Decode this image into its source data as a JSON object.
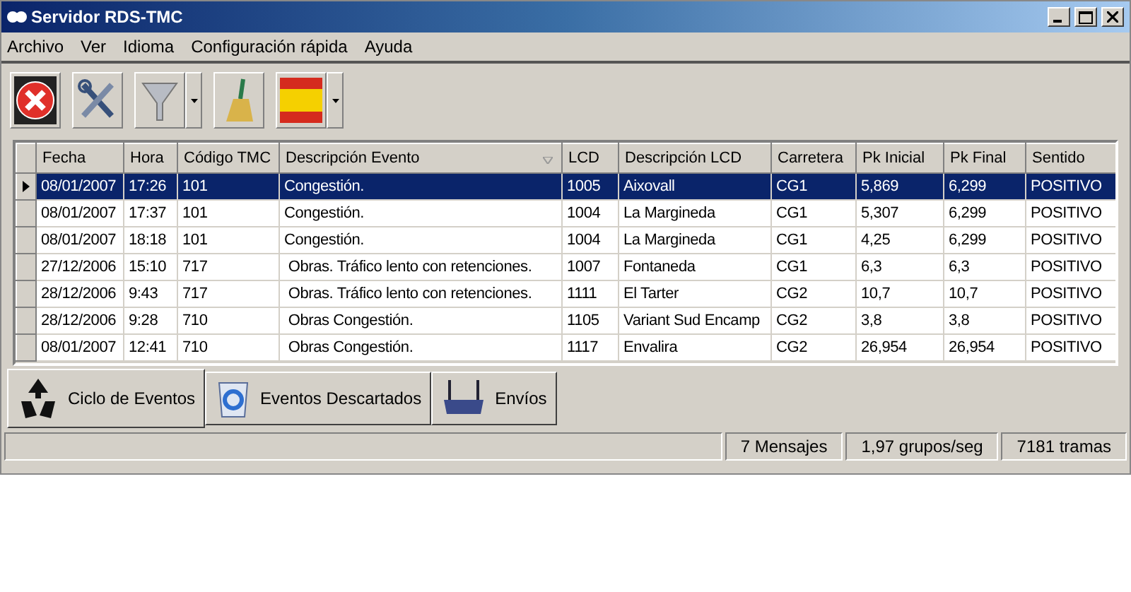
{
  "window": {
    "title": "Servidor RDS-TMC"
  },
  "menu": [
    "Archivo",
    "Ver",
    "Idioma",
    "Configuración rápida",
    "Ayuda"
  ],
  "toolbar": [
    {
      "kind": "exit",
      "dropdown": false
    },
    {
      "kind": "tools",
      "dropdown": false
    },
    {
      "kind": "filter",
      "dropdown": true
    },
    {
      "kind": "broom",
      "dropdown": false
    },
    {
      "kind": "flag",
      "dropdown": true
    }
  ],
  "table": {
    "columns": [
      {
        "label": "Fecha",
        "sorted": false
      },
      {
        "label": "Hora",
        "sorted": false
      },
      {
        "label": "Código TMC",
        "sorted": false
      },
      {
        "label": "Descripción Evento",
        "sorted": true
      },
      {
        "label": "LCD",
        "sorted": false
      },
      {
        "label": "Descripción LCD",
        "sorted": false
      },
      {
        "label": "Carretera",
        "sorted": false
      },
      {
        "label": "Pk Inicial",
        "sorted": false
      },
      {
        "label": "Pk Final",
        "sorted": false
      },
      {
        "label": "Sentido",
        "sorted": false
      }
    ],
    "rows": [
      {
        "selected": true,
        "cells": [
          "08/01/2007",
          "17:26",
          "101",
          "Congestión.",
          "1005",
          "Aixovall",
          "CG1",
          "5,869",
          "6,299",
          "POSITIVO"
        ]
      },
      {
        "selected": false,
        "cells": [
          "08/01/2007",
          "17:37",
          "101",
          "Congestión.",
          "1004",
          "La Margineda",
          "CG1",
          "5,307",
          "6,299",
          "POSITIVO"
        ]
      },
      {
        "selected": false,
        "cells": [
          "08/01/2007",
          "18:18",
          "101",
          "Congestión.",
          "1004",
          "La Margineda",
          "CG1",
          "4,25",
          "6,299",
          "POSITIVO"
        ]
      },
      {
        "selected": false,
        "cells": [
          "27/12/2006",
          "15:10",
          "717",
          " Obras. Tráfico lento con retenciones.",
          "1007",
          "Fontaneda",
          "CG1",
          "6,3",
          "6,3",
          "POSITIVO"
        ]
      },
      {
        "selected": false,
        "cells": [
          "28/12/2006",
          "9:43",
          "717",
          " Obras. Tráfico lento con retenciones.",
          "1111",
          "El Tarter",
          "CG2",
          "10,7",
          "10,7",
          "POSITIVO"
        ]
      },
      {
        "selected": false,
        "cells": [
          "28/12/2006",
          "9:28",
          "710",
          " Obras Congestión.",
          "1105",
          "Variant Sud Encamp",
          "CG2",
          "3,8",
          "3,8",
          "POSITIVO"
        ]
      },
      {
        "selected": false,
        "cells": [
          "08/01/2007",
          "12:41",
          "710",
          " Obras Congestión.",
          "1117",
          "Envalira",
          "CG2",
          "26,954",
          "26,954",
          "POSITIVO"
        ]
      }
    ]
  },
  "tabs": [
    {
      "label": "Ciclo de Eventos",
      "kind": "recycle",
      "selected": true
    },
    {
      "label": "Eventos Descartados",
      "kind": "bin",
      "selected": false
    },
    {
      "label": "Envíos",
      "kind": "router",
      "selected": false
    }
  ],
  "status_bar": [
    "7 Mensajes",
    "1,97 grupos/seg",
    "7181 tramas"
  ]
}
